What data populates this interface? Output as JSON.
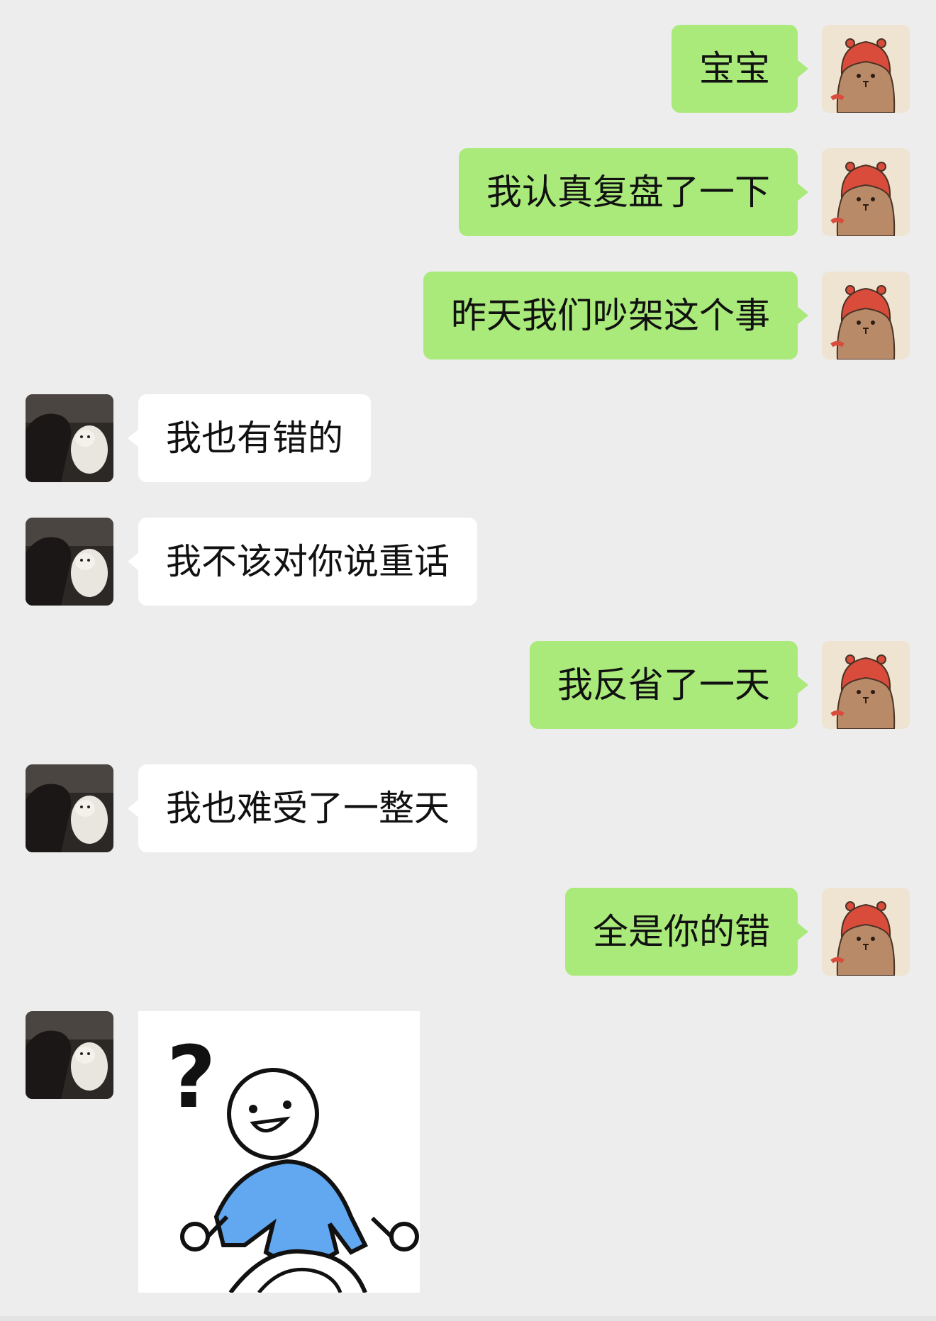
{
  "chat": {
    "messages": [
      {
        "side": "self",
        "text": "宝宝"
      },
      {
        "side": "self",
        "text": "我认真复盘了一下"
      },
      {
        "side": "self",
        "text": "昨天我们吵架这个事"
      },
      {
        "side": "other",
        "text": "我也有错的"
      },
      {
        "side": "other",
        "text": "我不该对你说重话"
      },
      {
        "side": "self",
        "text": "我反省了一天"
      },
      {
        "side": "other",
        "text": "我也难受了一整天"
      },
      {
        "side": "self",
        "text": "全是你的错"
      }
    ],
    "sticker": {
      "type": "sticker",
      "icon": "question-mark-stick-figure",
      "glyph": "?"
    }
  },
  "colors": {
    "background": "#ededed",
    "self_bubble": "#a9ea7a",
    "other_bubble": "#ffffff",
    "sticker_shirt": "#62a8f0"
  },
  "avatars": {
    "self_icon": "capybara-red-hood-avatar",
    "other_icon": "person-with-dog-photo-avatar"
  }
}
